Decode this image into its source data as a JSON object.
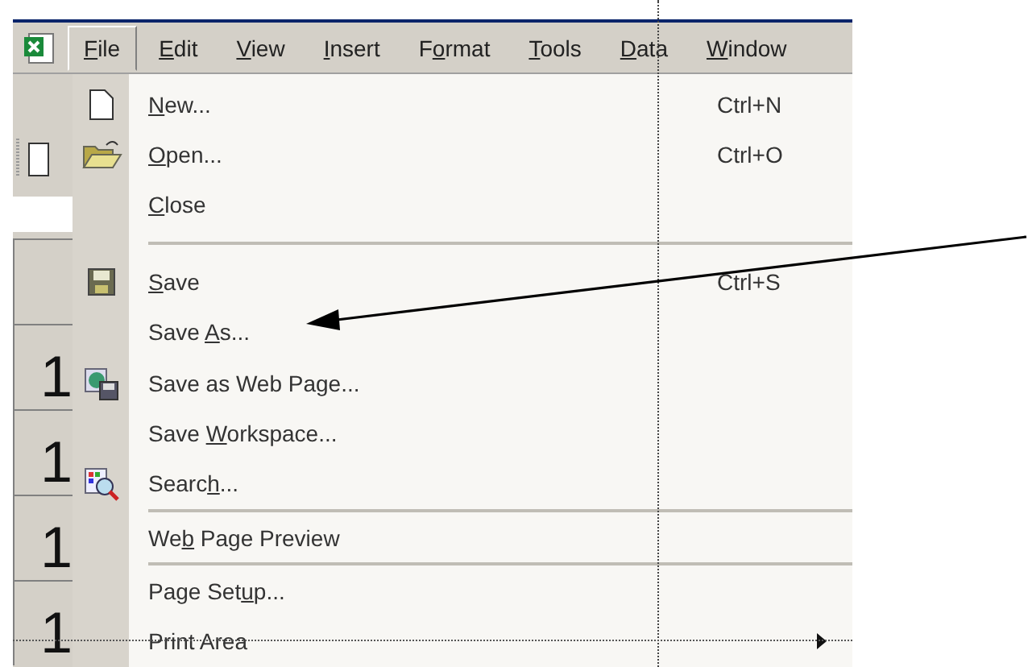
{
  "menu_bar": [
    {
      "key": "F",
      "after": "ile",
      "selected": true
    },
    {
      "key": "E",
      "after": "dit",
      "selected": false
    },
    {
      "key": "V",
      "after": "iew",
      "selected": false
    },
    {
      "key": "I",
      "after": "nsert",
      "selected": false
    },
    {
      "before": "F",
      "key": "o",
      "after": "rmat",
      "selected": false
    },
    {
      "key": "T",
      "after": "ools",
      "selected": false
    },
    {
      "key": "D",
      "after": "ata",
      "selected": false
    },
    {
      "key": "W",
      "after": "indow",
      "selected": false
    }
  ],
  "file_menu": [
    {
      "kind": "item",
      "key": "N",
      "after": "ew...",
      "shortcut": "Ctrl+N"
    },
    {
      "kind": "item",
      "key": "O",
      "after": "pen...",
      "shortcut": "Ctrl+O"
    },
    {
      "kind": "item",
      "key": "C",
      "after": "lose"
    },
    {
      "kind": "separator"
    },
    {
      "kind": "item",
      "key": "S",
      "after": "ave",
      "shortcut": "Ctrl+S"
    },
    {
      "kind": "item",
      "before": "Save ",
      "key": "A",
      "after": "s..."
    },
    {
      "kind": "item",
      "before": "Save as Web Page..."
    },
    {
      "kind": "item",
      "before": "Save ",
      "key": "W",
      "after": "orkspace..."
    },
    {
      "kind": "item",
      "before": "Searc",
      "key": "h",
      "after": "..."
    },
    {
      "kind": "separator"
    },
    {
      "kind": "item",
      "before": "We",
      "key": "b",
      "after": " Page Preview"
    },
    {
      "kind": "separator"
    },
    {
      "kind": "item",
      "before": "Page Set",
      "key": "u",
      "after": "p..."
    },
    {
      "kind": "submenu",
      "before": "Print Area"
    }
  ],
  "row_headers": [
    "1",
    "1",
    "1",
    "1"
  ]
}
